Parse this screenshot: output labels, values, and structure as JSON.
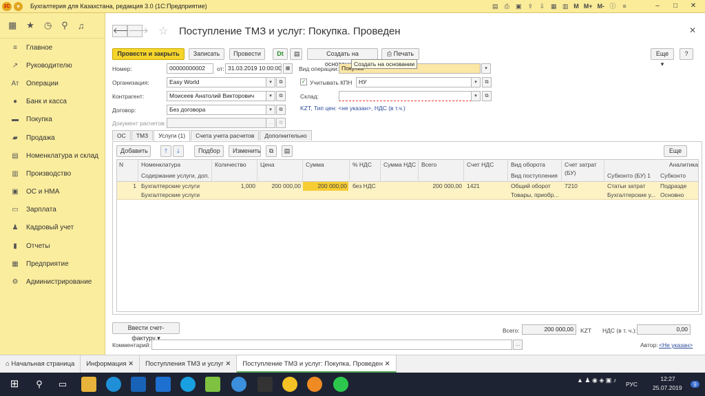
{
  "window": {
    "title": "Бухгалтерия для Казахстана, редакция 3.0  (1С:Предприятие)",
    "logo": "1С",
    "icons_text": [
      "M",
      "M+",
      "M-"
    ]
  },
  "sidebar": {
    "items": [
      {
        "label": "Главное",
        "icon": "menu-icon"
      },
      {
        "label": "Руководителю",
        "icon": "chart-icon"
      },
      {
        "label": "Операции",
        "icon": "operations-icon"
      },
      {
        "label": "Банк и касса",
        "icon": "bank-icon"
      },
      {
        "label": "Покупка",
        "icon": "cart-icon"
      },
      {
        "label": "Продажа",
        "icon": "sale-icon"
      },
      {
        "label": "Номенклатура и склад",
        "icon": "warehouse-icon"
      },
      {
        "label": "Производство",
        "icon": "production-icon"
      },
      {
        "label": "ОС и НМА",
        "icon": "assets-icon"
      },
      {
        "label": "Зарплата",
        "icon": "salary-icon"
      },
      {
        "label": "Кадровый учет",
        "icon": "staff-icon"
      },
      {
        "label": "Отчеты",
        "icon": "reports-icon"
      },
      {
        "label": "Предприятие",
        "icon": "enterprise-icon"
      },
      {
        "label": "Администрирование",
        "icon": "gear-icon"
      }
    ]
  },
  "doc": {
    "title": "Поступление ТМЗ и услуг: Покупка. Проведен"
  },
  "toolbar": {
    "post_close": "Провести и закрыть",
    "save": "Записать",
    "post": "Провести",
    "create_based": "Создать на основании",
    "print": "Печать",
    "more": "Еще",
    "help": "?",
    "tooltip": "Создать на основании"
  },
  "form": {
    "number_label": "Номер:",
    "number": "00000000002",
    "from_label": "от:",
    "date": "31.03.2019 10:00:00",
    "op_label": "Вид операции:",
    "op": "Покупка",
    "org_label": "Организация:",
    "org": "Easy World",
    "kpn_label": "Учитывать КПН",
    "kpn": "НУ",
    "contractor_label": "Контрагент:",
    "contractor": "Моисеев Анатолий Викторович",
    "warehouse_label": "Склад:",
    "warehouse": "",
    "contract_label": "Договор:",
    "contract": "Без договора",
    "price_link": "KZT, Тип цен: <не указан>, НДС (в т.ч.)",
    "settle_label": "Документ расчетов:",
    "settle": ""
  },
  "tabs": [
    "ОС",
    "ТМЗ",
    "Услуги (1)",
    "Счета учета расчетов",
    "Дополнительно"
  ],
  "table": {
    "add": "Добавить",
    "pick": "Подбор",
    "edit": "Изменить",
    "more": "Еще",
    "headers": {
      "n": "N",
      "nom": "Номенклатура",
      "nom2": "Содержание услуги, доп.",
      "qty": "Количество",
      "price": "Цена",
      "sum": "Сумма",
      "vat_pct": "% НДС",
      "vat_sum": "Сумма НДС",
      "total": "Всего",
      "vat_acc": "Счет НДС",
      "turnover": "Вид оборота",
      "turnover2": "Вид поступления",
      "cost_acc": "Счет затрат",
      "cost_acc2": "(БУ)",
      "sub1": "Субконто (БУ) 1",
      "analytics": "Аналитика",
      "sub2": "Субконто"
    },
    "row": {
      "n": "1",
      "nom": "Бухгалтерские услуги",
      "nom2": "Бухгалтерские услуги",
      "qty": "1,000",
      "price": "200 000,00",
      "sum": "200 000,00",
      "vat_pct": "без НДС",
      "total": "200 000,00",
      "vat_acc": "1421",
      "turnover": "Общий оборот",
      "turnover2": "Товары, приобр...",
      "cost_acc": "7210",
      "sub1": "Статьи затрат",
      "sub1b": "Бухгалтерские у...",
      "sub2": "Подразде",
      "sub2b": "Основно"
    }
  },
  "footer": {
    "invoice": "Ввести счет-фактуру",
    "total_label": "Всего:",
    "total": "200 000,00",
    "currency": "KZT",
    "vat_label": "НДС (в т. ч.):",
    "vat": "0,00",
    "comment_label": "Комментарий:",
    "author_label": "Автор:",
    "author": "<Не указан>"
  },
  "open_tabs": [
    "Начальная страница",
    "Информация",
    "Поступления ТМЗ и услуг",
    "Поступление ТМЗ и услуг: Покупка. Проведен"
  ],
  "tray": {
    "lang": "РУС",
    "time": "12:27",
    "date": "25.07.2019",
    "badge": "9"
  }
}
